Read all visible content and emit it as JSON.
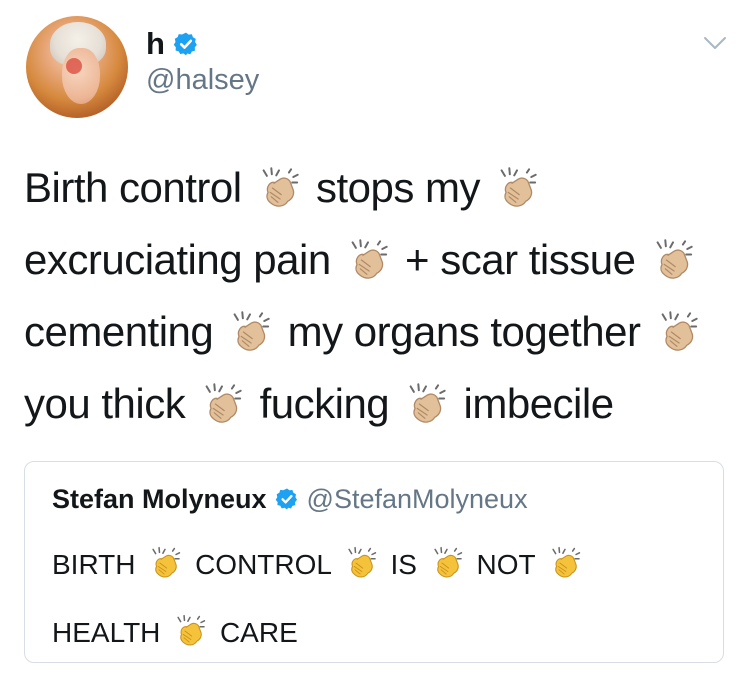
{
  "author": {
    "display_name": "h",
    "handle": "@halsey",
    "verified": true
  },
  "tweet": {
    "segments": [
      {
        "text": "Birth control",
        "clap": true
      },
      {
        "text": "stops my",
        "clap": true
      },
      {
        "text": "excruciating pain",
        "clap": true
      },
      {
        "text": "+ scar tissue",
        "clap": true
      },
      {
        "text": "cementing",
        "clap": true
      },
      {
        "text": "my organs together",
        "clap": true
      },
      {
        "text": "you thick",
        "clap": true
      },
      {
        "text": "fucking",
        "clap": true
      },
      {
        "text": "imbecile",
        "clap": false
      }
    ]
  },
  "quoted_tweet": {
    "display_name": "Stefan Molyneux",
    "handle": "@StefanMolyneux",
    "verified": true,
    "segments": [
      {
        "text": "BIRTH",
        "clap": true
      },
      {
        "text": "CONTROL",
        "clap": true
      },
      {
        "text": "IS",
        "clap": true
      },
      {
        "text": "NOT",
        "clap": true
      },
      {
        "text": "HEALTH",
        "clap": true
      },
      {
        "text": "CARE",
        "clap": false
      }
    ]
  },
  "icons": {
    "verified": "verified-badge-icon",
    "menu": "chevron-down-icon",
    "clap_light": "clapping-hands-light-skin-icon",
    "clap_yellow": "clapping-hands-yellow-icon"
  },
  "colors": {
    "verified_blue": "#1da1f2",
    "secondary_text": "#657786",
    "border": "#d8dee3",
    "clap_light_skin": "#e2c09a",
    "clap_yellow": "#f5c33b"
  }
}
